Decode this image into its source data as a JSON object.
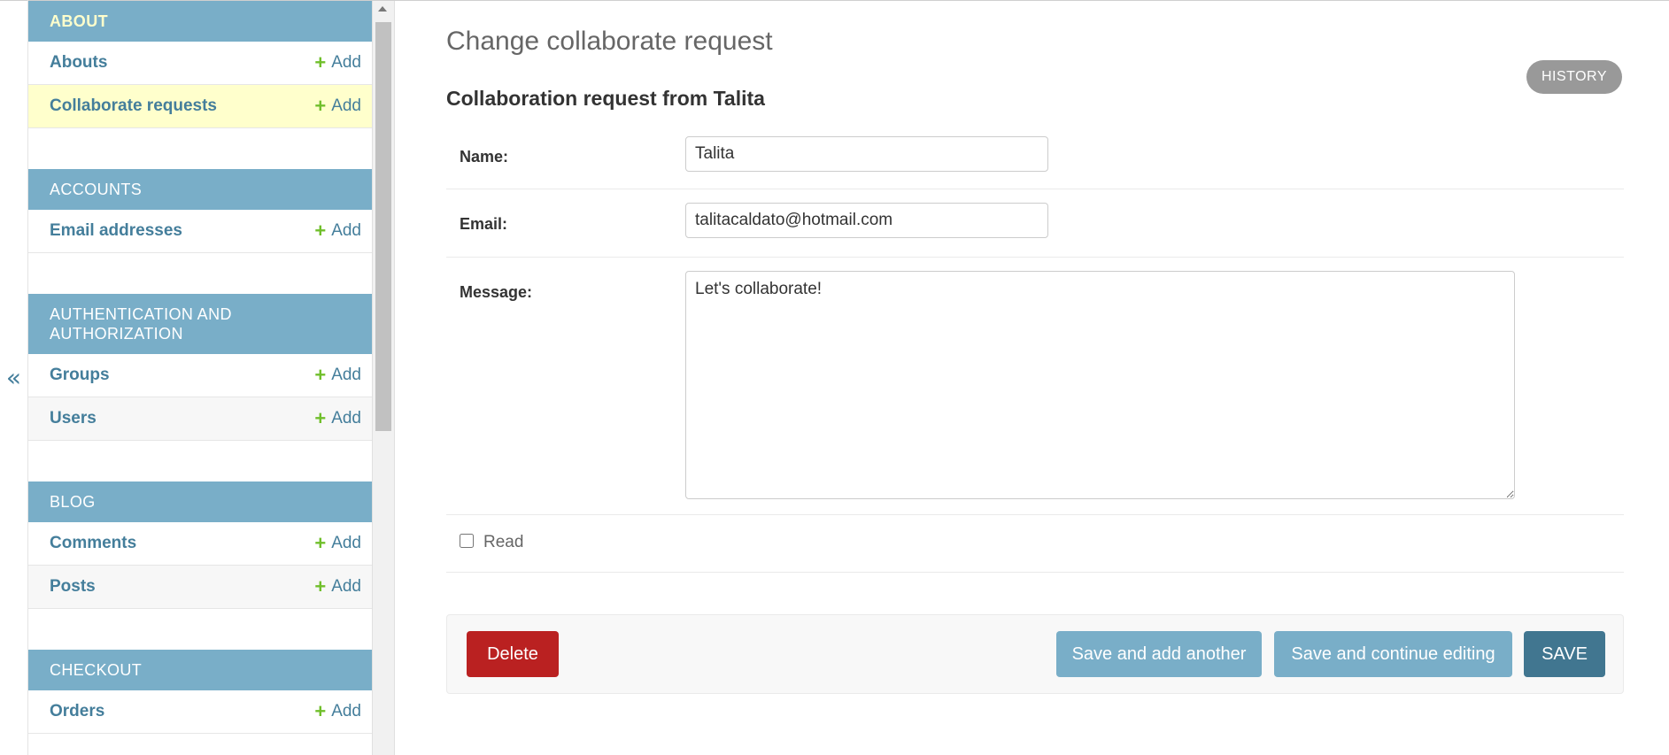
{
  "nav_toggle": {
    "glyph": "«"
  },
  "sidebar": {
    "modules": [
      {
        "title": "About",
        "current": true,
        "models": [
          {
            "name": "Abouts",
            "add_label": "Add",
            "selected": false
          },
          {
            "name": "Collaborate requests",
            "add_label": "Add",
            "selected": true
          }
        ]
      },
      {
        "title": "Accounts",
        "current": false,
        "models": [
          {
            "name": "Email addresses",
            "add_label": "Add",
            "selected": false
          }
        ]
      },
      {
        "title": "Authentication and Authorization",
        "current": false,
        "models": [
          {
            "name": "Groups",
            "add_label": "Add",
            "selected": false
          },
          {
            "name": "Users",
            "add_label": "Add",
            "selected": false
          }
        ]
      },
      {
        "title": "Blog",
        "current": false,
        "models": [
          {
            "name": "Comments",
            "add_label": "Add",
            "selected": false
          },
          {
            "name": "Posts",
            "add_label": "Add",
            "selected": false
          }
        ]
      },
      {
        "title": "Checkout",
        "current": false,
        "models": [
          {
            "name": "Orders",
            "add_label": "Add",
            "selected": false
          }
        ]
      }
    ]
  },
  "page": {
    "title": "Change collaborate request",
    "history_label": "History",
    "object_title": "Collaboration request from Talita"
  },
  "form": {
    "name_label": "Name:",
    "name_value": "Talita",
    "email_label": "Email:",
    "email_value": "talitacaldato@hotmail.com",
    "message_label": "Message:",
    "message_value": "Let's collaborate!",
    "read_label": "Read",
    "read_checked": false
  },
  "actions": {
    "delete_label": "Delete",
    "save_add_label": "Save and add another",
    "save_continue_label": "Save and continue editing",
    "save_label": "Save"
  },
  "colors": {
    "header_bg": "#79aec8",
    "link": "#447e9b",
    "add_icon": "#70bf2b",
    "selected_row": "#ffffcc",
    "delete": "#ba2121",
    "save_primary": "#417690"
  },
  "icons": {
    "add": "plus-icon",
    "collapse": "double-chevron-left-icon"
  }
}
